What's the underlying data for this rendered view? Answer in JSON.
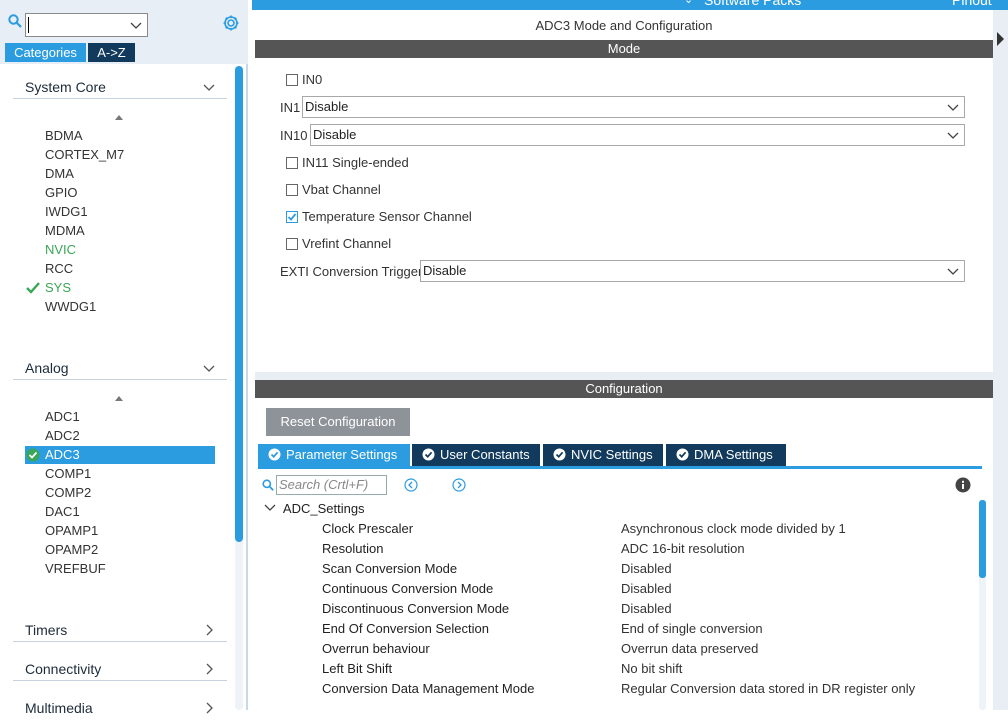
{
  "topbar": {
    "software_packs": "Software Packs",
    "pinout": "Pinout"
  },
  "left": {
    "search_value": "",
    "tabs": {
      "categories": "Categories",
      "az": "A->Z"
    },
    "categories": [
      {
        "label": "System Core",
        "items": [
          "BDMA",
          "CORTEX_M7",
          "DMA",
          "GPIO",
          "IWDG1",
          "MDMA",
          "NVIC",
          "RCC",
          "SYS",
          "WWDG1"
        ]
      },
      {
        "label": "Analog",
        "items": [
          "ADC1",
          "ADC2",
          "ADC3",
          "COMP1",
          "COMP2",
          "DAC1",
          "OPAMP1",
          "OPAMP2",
          "VREFBUF"
        ]
      },
      {
        "label": "Timers"
      },
      {
        "label": "Connectivity"
      },
      {
        "label": "Multimedia"
      }
    ]
  },
  "panel": {
    "title": "ADC3 Mode and Configuration",
    "mode_bar": "Mode",
    "config_bar": "Configuration"
  },
  "mode": {
    "in0": {
      "label": "IN0",
      "checked": false
    },
    "in1": {
      "label": "IN1",
      "value": "Disable"
    },
    "in10": {
      "label": "IN10",
      "value": "Disable"
    },
    "in11": {
      "label": "IN11 Single-ended",
      "checked": false
    },
    "vbat": {
      "label": "Vbat Channel",
      "checked": false
    },
    "temp": {
      "label": "Temperature Sensor Channel",
      "checked": true
    },
    "vrefint": {
      "label": "Vrefint Channel",
      "checked": false
    },
    "exti": {
      "label": "EXTI Conversion Trigger",
      "value": "Disable"
    }
  },
  "config": {
    "reset_label": "Reset Configuration",
    "tabs": [
      "Parameter Settings",
      "User Constants",
      "NVIC Settings",
      "DMA Settings"
    ],
    "search_placeholder": "Search (Crtl+F)",
    "group": "ADC_Settings",
    "params": [
      {
        "name": "Clock Prescaler",
        "value": "Asynchronous clock mode divided by 1"
      },
      {
        "name": "Resolution",
        "value": "ADC 16-bit resolution"
      },
      {
        "name": "Scan Conversion Mode",
        "value": "Disabled"
      },
      {
        "name": "Continuous Conversion Mode",
        "value": "Disabled"
      },
      {
        "name": "Discontinuous Conversion Mode",
        "value": "Disabled"
      },
      {
        "name": "End Of Conversion Selection",
        "value": "End of single conversion"
      },
      {
        "name": "Overrun behaviour",
        "value": "Overrun data preserved"
      },
      {
        "name": "Left Bit Shift",
        "value": "No bit shift"
      },
      {
        "name": "Conversion Data Management Mode",
        "value": "Regular Conversion data stored in DR register only"
      }
    ]
  },
  "colors": {
    "accent": "#2b9ce0",
    "dark_tab": "#123a5c",
    "header_bar": "#555555",
    "ok_green": "#3aa657"
  }
}
